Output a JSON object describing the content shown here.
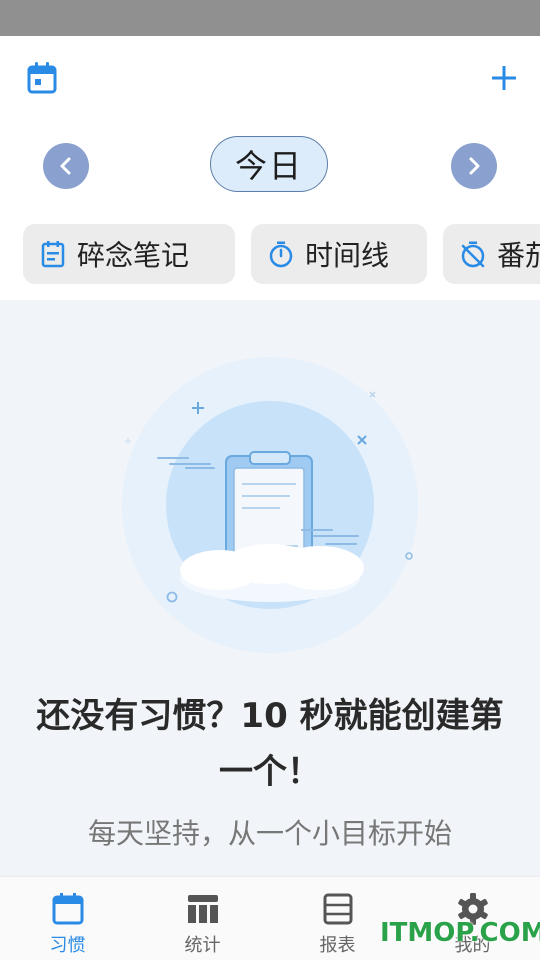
{
  "header": {
    "calendar_icon": "calendar-icon",
    "add_icon": "plus-icon",
    "accent_color": "#2a8be6"
  },
  "date_nav": {
    "prev_icon": "chevron-left-icon",
    "next_icon": "chevron-right-icon",
    "current_label": "今日"
  },
  "chips": [
    {
      "label": "碎念笔记",
      "icon": "note-icon"
    },
    {
      "label": "时间线",
      "icon": "stopwatch-icon"
    },
    {
      "label": "番茄",
      "icon": "timer-off-icon"
    }
  ],
  "empty_state": {
    "illustration": "clipboard-illustration",
    "title": "还没有习惯？10 秒就能创建第一个！",
    "subtitle": "每天坚持，从一个小目标开始"
  },
  "bottom_nav": [
    {
      "label": "习惯",
      "icon": "calendar-icon",
      "active": true
    },
    {
      "label": "统计",
      "icon": "columns-icon",
      "active": false
    },
    {
      "label": "报表",
      "icon": "list-icon",
      "active": false
    },
    {
      "label": "我的",
      "icon": "gear-icon",
      "active": false
    }
  ],
  "watermark": "ITMOP.COM"
}
